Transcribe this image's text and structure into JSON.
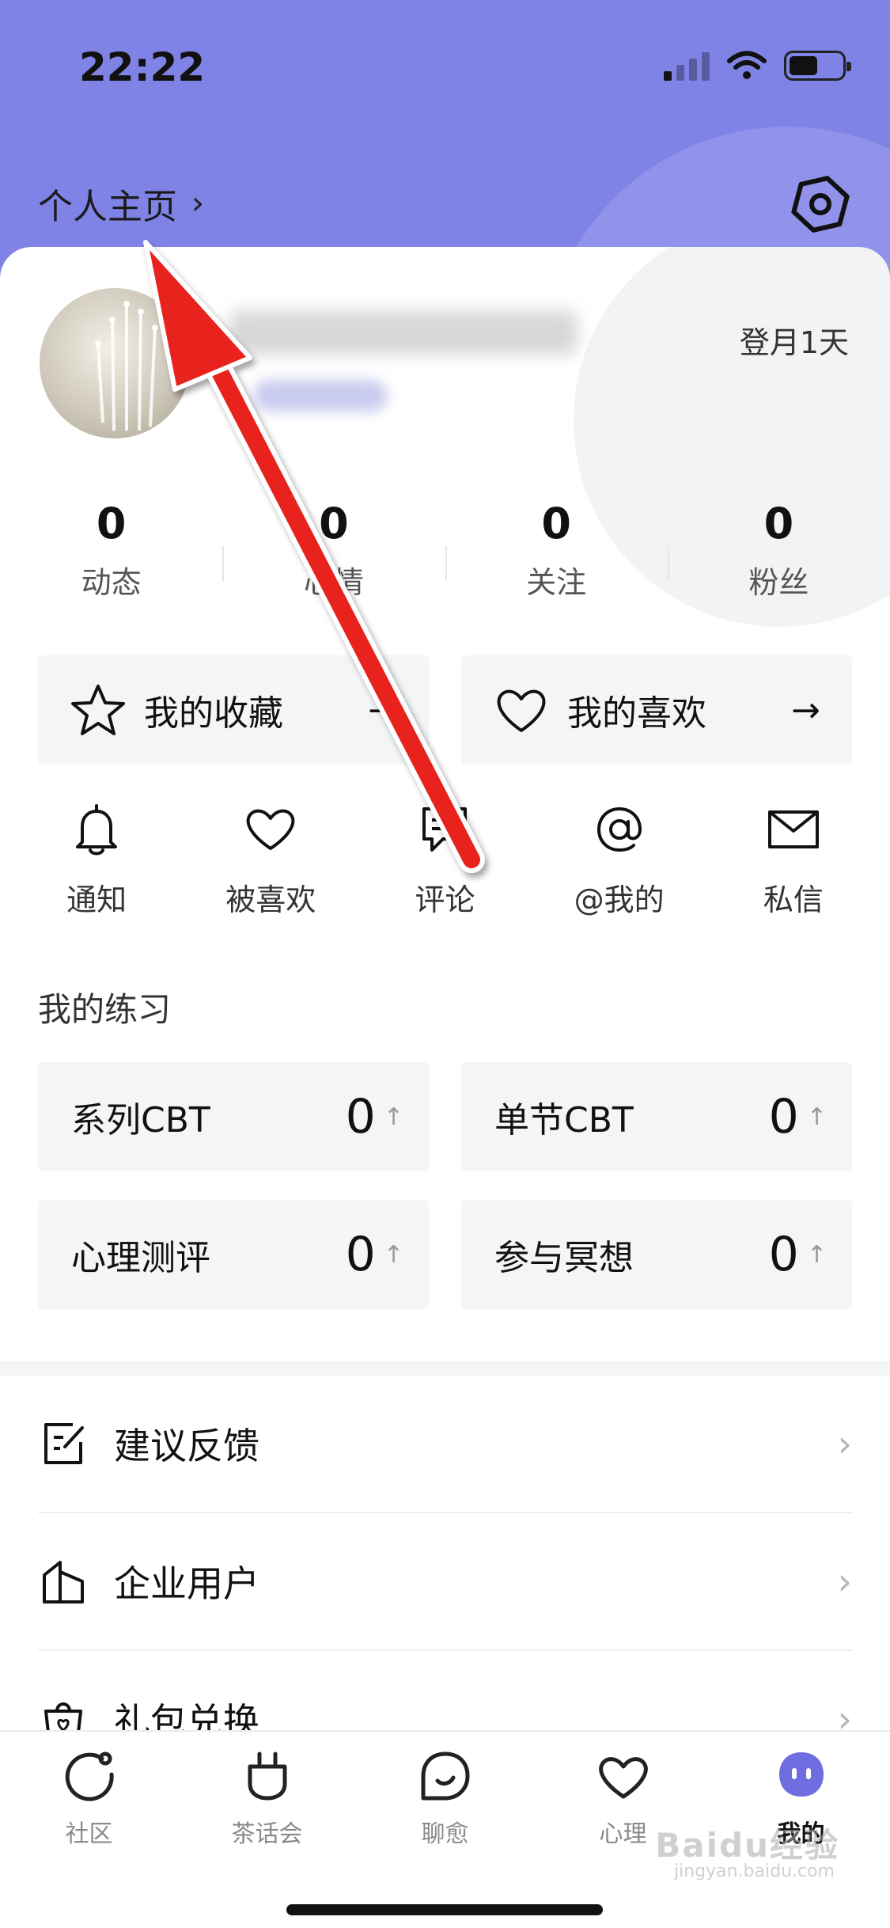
{
  "status_bar": {
    "time": "22:22"
  },
  "header": {
    "profile_link": "个人主页",
    "chevron": "›"
  },
  "profile": {
    "login_days": "登月1天"
  },
  "stats": [
    {
      "num": "0",
      "label": "动态"
    },
    {
      "num": "0",
      "label": "心情"
    },
    {
      "num": "0",
      "label": "关注"
    },
    {
      "num": "0",
      "label": "粉丝"
    }
  ],
  "favorites": [
    {
      "icon": "star-icon",
      "label": "我的收藏",
      "arrow": "→"
    },
    {
      "icon": "heart-icon",
      "label": "我的喜欢",
      "arrow": "→"
    }
  ],
  "quick_actions": [
    {
      "icon": "bell-icon",
      "label": "通知"
    },
    {
      "icon": "heart-outline-icon",
      "label": "被喜欢"
    },
    {
      "icon": "comment-icon",
      "label": "评论"
    },
    {
      "icon": "at-icon",
      "label": "@我的"
    },
    {
      "icon": "mail-icon",
      "label": "私信"
    }
  ],
  "practice": {
    "title": "我的练习",
    "items": [
      {
        "label": "系列CBT",
        "value": "0",
        "trend": "↑"
      },
      {
        "label": "单节CBT",
        "value": "0",
        "trend": "↑"
      },
      {
        "label": "心理测评",
        "value": "0",
        "trend": "↑"
      },
      {
        "label": "参与冥想",
        "value": "0",
        "trend": "↑"
      }
    ]
  },
  "menu": [
    {
      "icon": "feedback-icon",
      "label": "建议反馈",
      "chevron": "›"
    },
    {
      "icon": "building-icon",
      "label": "企业用户",
      "chevron": "›"
    },
    {
      "icon": "gift-bag-icon",
      "label": "礼包兑换",
      "chevron": "›"
    }
  ],
  "tabbar": {
    "active": "我的",
    "tabs": [
      {
        "icon": "community-icon",
        "label": "社区"
      },
      {
        "icon": "tea-party-icon",
        "label": "茶话会"
      },
      {
        "icon": "chat-icon",
        "label": "聊愈"
      },
      {
        "icon": "heart-tab-icon",
        "label": "心理"
      },
      {
        "icon": "mine-face-icon",
        "label": "我的"
      }
    ]
  },
  "watermark": {
    "main": "Baidu经验",
    "sub": "jingyan.baidu.com"
  },
  "colors": {
    "hero": "#8083e6",
    "accent_purple": "#6f6ee0",
    "annotation_arrow": "#e8221c",
    "panel_bg": "#f4f5f7"
  }
}
